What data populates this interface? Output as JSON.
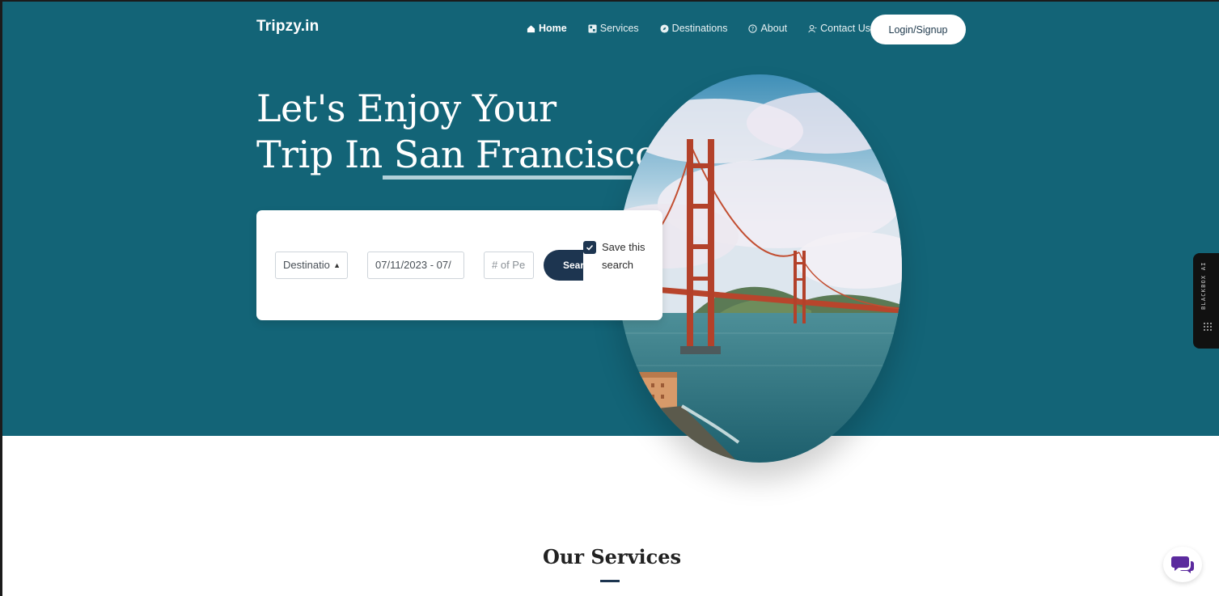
{
  "brand": {
    "logo": "Tripzy.in"
  },
  "nav": {
    "items": [
      {
        "label": "Home",
        "icon": "home-icon"
      },
      {
        "label": "Services",
        "icon": "services-icon"
      },
      {
        "label": "Destinations",
        "icon": "compass-icon"
      },
      {
        "label": "About",
        "icon": "question-circle-icon"
      },
      {
        "label": "Contact Us",
        "icon": "person-icon"
      }
    ],
    "login_label": "Login/Signup"
  },
  "hero": {
    "line1": "Let's Enjoy Your",
    "line2_prefix": "Trip In ",
    "line2_highlight": "San Francisco",
    "line2_suffix": "."
  },
  "search": {
    "destination_value": "Destinatio",
    "date_value": "07/11/2023 - 07/",
    "people_placeholder": "# of Pe",
    "search_label": "Sear",
    "save_label": "Save this search",
    "save_checked": true
  },
  "side_tab": {
    "label": "BLACKBOX AI"
  },
  "services": {
    "title": "Our Services"
  },
  "colors": {
    "hero_bg": "#136477",
    "accent_dark": "#1d3550",
    "chat_icon": "#5b2a9e"
  }
}
